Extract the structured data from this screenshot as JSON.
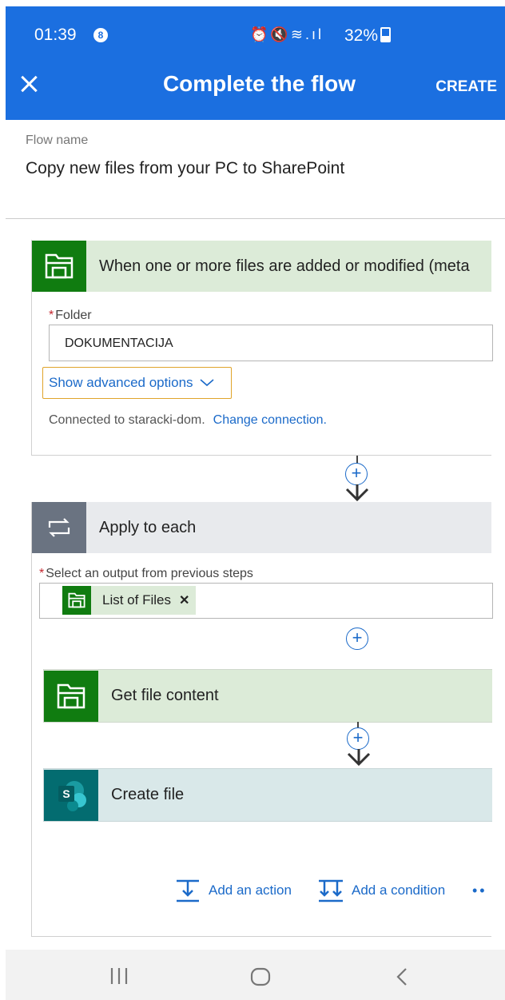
{
  "status_bar": {
    "time": "01:39",
    "notification_count": "8",
    "battery": "32%"
  },
  "app_bar": {
    "title": "Complete the flow",
    "create_label": "CREATE"
  },
  "flow_name": {
    "label": "Flow name",
    "value": "Copy new files from your PC to SharePoint"
  },
  "trigger": {
    "title": "When one or more files are added or modified (meta",
    "folder_label": "Folder",
    "folder_value": "DOKUMENTACIJA",
    "advanced_label": "Show advanced options",
    "connection_text": "Connected to staracki-dom.",
    "change_connection": "Change connection."
  },
  "apply_each": {
    "title": "Apply to each",
    "select_label": "Select an output from previous steps",
    "token": "List of Files"
  },
  "get_file": {
    "title": "Get file content"
  },
  "create_file": {
    "title": "Create file"
  },
  "actions": {
    "add_action": "Add an action",
    "add_condition": "Add a condition"
  },
  "colors": {
    "primary": "#1b6fe0",
    "onedrive_green": "#107c10",
    "sharepoint_teal": "#036c70",
    "link": "#1b6ac9"
  }
}
